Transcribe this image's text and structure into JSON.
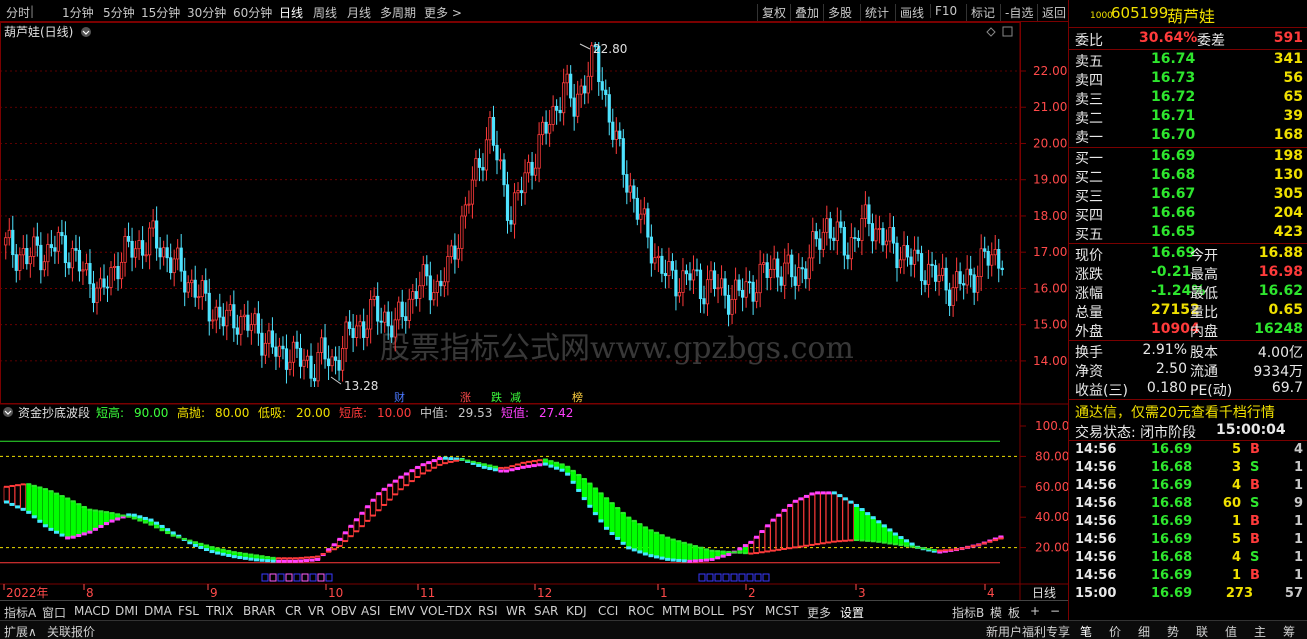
{
  "toolbar": {
    "periods": [
      "分时",
      "1分钟",
      "5分钟",
      "15分钟",
      "30分钟",
      "60分钟",
      "日线",
      "周线",
      "月线",
      "多周期",
      "更多 >"
    ],
    "active": "日线",
    "tools": [
      "复权",
      "叠加",
      "多股",
      "统计",
      "画线",
      "F10",
      "标记",
      "-自选",
      "返回"
    ]
  },
  "main_chart": {
    "title": "葫芦娃(日线)",
    "high_label": "22.80",
    "low_label": "13.28",
    "watermark": "股票指标公式网www.gpzbgs.com",
    "markers": [
      {
        "text": "财",
        "color": "#4a78ff"
      },
      {
        "text": "涨",
        "color": "#ff4a4a"
      },
      {
        "text": "跌",
        "color": "#3cff3c"
      },
      {
        "text": "减",
        "color": "#3cff3c"
      },
      {
        "text": "榜",
        "color": "#ffd040"
      }
    ]
  },
  "indicator": {
    "name": "资金抄底波段",
    "params": [
      {
        "label": "短高:",
        "value": "90.00",
        "color": "#3cff3c"
      },
      {
        "label": "高抛:",
        "value": "80.00",
        "color": "#f0e000"
      },
      {
        "label": "低吸:",
        "value": "20.00",
        "color": "#f0e000"
      },
      {
        "label": "短底:",
        "value": "10.00",
        "color": "#ff3b3b"
      },
      {
        "label": "中值:",
        "value": "29.53",
        "color": "#c8c8c8"
      },
      {
        "label": "短值:",
        "value": "27.42",
        "color": "#ff40ff"
      }
    ]
  },
  "dates": [
    "2022年",
    "8",
    "9",
    "10",
    "11",
    "12",
    "1",
    "2",
    "3",
    "4"
  ],
  "period_label": "日线",
  "chart_data": [
    {
      "type": "candlestick",
      "title": "葫芦娃(日线)",
      "ylim": [
        13.28,
        22.8
      ],
      "yticks": [
        "22.00",
        "21.00",
        "20.00",
        "19.00",
        "18.00",
        "17.00",
        "16.00",
        "15.00",
        "14.00"
      ],
      "high": 22.8,
      "low": 13.28,
      "close_trend": [
        17.2,
        17.0,
        16.8,
        17.1,
        16.9,
        17.3,
        17.0,
        16.6,
        16.3,
        15.8,
        16.4,
        16.9,
        17.1,
        17.2,
        17.4,
        17.0,
        16.7,
        16.3,
        16.0,
        15.6,
        15.3,
        15.1,
        15.2,
        15.0,
        14.8,
        14.5,
        14.1,
        14.3,
        14.0,
        13.8,
        14.2,
        13.9,
        14.4,
        14.9,
        15.0,
        15.4,
        15.2,
        14.9,
        15.5,
        16.0,
        16.2,
        16.0,
        16.5,
        17.5,
        18.5,
        19.5,
        20.4,
        19.2,
        18.0,
        18.8,
        19.5,
        20.2,
        20.8,
        21.6,
        21.0,
        21.8,
        22.4,
        21.2,
        20.0,
        19.0,
        18.2,
        17.4,
        16.7,
        16.3,
        16.2,
        16.4,
        16.0,
        16.2,
        15.9,
        15.8,
        15.9,
        16.1,
        16.4,
        16.6,
        16.5,
        16.3,
        16.7,
        17.2,
        17.8,
        17.4,
        17.1,
        17.6,
        17.9,
        17.5,
        17.2,
        17.0,
        16.8,
        16.6,
        16.4,
        16.2,
        16.0,
        16.2,
        16.4,
        16.8,
        16.9
      ]
    },
    {
      "type": "line",
      "title": "资金抄底波段",
      "ylim": [
        0,
        100
      ],
      "yticks": [
        "100.0",
        "80.00",
        "60.00",
        "40.00",
        "20.00"
      ],
      "thresholds": {
        "短高": 90,
        "高抛": 80,
        "低吸": 20,
        "短底": 10
      },
      "series": [
        {
          "name": "中值",
          "values": [
            60,
            62,
            58,
            52,
            45,
            43,
            40,
            35,
            28,
            24,
            20,
            17,
            15,
            13,
            13,
            14,
            20,
            32,
            45,
            58,
            68,
            75,
            78,
            75,
            72,
            76,
            78,
            74,
            64,
            52,
            40,
            32,
            26,
            22,
            18,
            17,
            16,
            18,
            20,
            22,
            24,
            25,
            24,
            22,
            20,
            18,
            19,
            22,
            26
          ]
        },
        {
          "name": "短值",
          "values": [
            50,
            44,
            33,
            26,
            30,
            37,
            42,
            38,
            30,
            22,
            17,
            14,
            12,
            11,
            11,
            12,
            24,
            40,
            56,
            66,
            74,
            79,
            78,
            73,
            70,
            73,
            75,
            70,
            50,
            32,
            20,
            15,
            12,
            11,
            12,
            16,
            24,
            38,
            50,
            56,
            56,
            48,
            38,
            28,
            20,
            17,
            19,
            22,
            27
          ]
        }
      ]
    }
  ],
  "quote_panel": {
    "code": "605199",
    "name": "葫芦娃",
    "code_prefix": "1000",
    "wei_bi_label": "委比",
    "wei_bi": "30.64%",
    "wei_cha_label": "委差",
    "wei_cha": "591",
    "asks": [
      {
        "label": "卖五",
        "price": "16.74",
        "vol": "341"
      },
      {
        "label": "卖四",
        "price": "16.73",
        "vol": "56"
      },
      {
        "label": "卖三",
        "price": "16.72",
        "vol": "65"
      },
      {
        "label": "卖二",
        "price": "16.71",
        "vol": "39"
      },
      {
        "label": "卖一",
        "price": "16.70",
        "vol": "168"
      }
    ],
    "bids": [
      {
        "label": "买一",
        "price": "16.69",
        "vol": "198"
      },
      {
        "label": "买二",
        "price": "16.68",
        "vol": "130"
      },
      {
        "label": "买三",
        "price": "16.67",
        "vol": "305"
      },
      {
        "label": "买四",
        "price": "16.66",
        "vol": "204"
      },
      {
        "label": "买五",
        "price": "16.65",
        "vol": "423"
      }
    ],
    "stats": [
      {
        "l1": "现价",
        "v1": "16.69",
        "c1": "grn",
        "l2": "今开",
        "v2": "16.88",
        "c2": "yel"
      },
      {
        "l1": "涨跌",
        "v1": "-0.21",
        "c1": "grn",
        "l2": "最高",
        "v2": "16.98",
        "c2": "red"
      },
      {
        "l1": "涨幅",
        "v1": "-1.24%",
        "c1": "grn",
        "l2": "最低",
        "v2": "16.62",
        "c2": "grn"
      },
      {
        "l1": "总量",
        "v1": "27152",
        "c1": "yel",
        "l2": "量比",
        "v2": "0.65",
        "c2": "yel"
      },
      {
        "l1": "外盘",
        "v1": "10904",
        "c1": "red",
        "l2": "内盘",
        "v2": "16248",
        "c2": "grn"
      }
    ],
    "fin": [
      {
        "l1": "换手",
        "v1": "2.91%",
        "l2": "股本",
        "v2": "4.00亿"
      },
      {
        "l1": "净资",
        "v1": "2.50",
        "l2": "流通",
        "v2": "9334万"
      },
      {
        "l1": "收益(三)",
        "v1": "0.180",
        "l2": "PE(动)",
        "v2": "69.7"
      }
    ],
    "ad": "通达信，仅需20元查看千档行情",
    "trade_status_label": "交易状态: 闭市阶段",
    "trade_time": "15:00:04",
    "ticks": [
      {
        "t": "14:56",
        "p": "16.69",
        "v": "5",
        "bs": "B",
        "n": "4"
      },
      {
        "t": "14:56",
        "p": "16.68",
        "v": "3",
        "bs": "S",
        "n": "1"
      },
      {
        "t": "14:56",
        "p": "16.69",
        "v": "4",
        "bs": "B",
        "n": "1"
      },
      {
        "t": "14:56",
        "p": "16.68",
        "v": "60",
        "bs": "S",
        "n": "9"
      },
      {
        "t": "14:56",
        "p": "16.69",
        "v": "1",
        "bs": "B",
        "n": "1"
      },
      {
        "t": "14:56",
        "p": "16.69",
        "v": "5",
        "bs": "B",
        "n": "1"
      },
      {
        "t": "14:56",
        "p": "16.68",
        "v": "4",
        "bs": "S",
        "n": "1"
      },
      {
        "t": "14:56",
        "p": "16.69",
        "v": "1",
        "bs": "B",
        "n": "1"
      },
      {
        "t": "15:00",
        "p": "16.69",
        "v": "273",
        "bs": "",
        "n": "57"
      }
    ],
    "tabs": [
      "笔",
      "价",
      "细",
      "势",
      "联",
      "值",
      "主",
      "筹"
    ]
  },
  "bottom_tabs": [
    "指标A",
    "窗口",
    "MACD",
    "DMI",
    "DMA",
    "FSL",
    "TRIX",
    "BRAR",
    "CR",
    "VR",
    "OBV",
    "ASI",
    "EMV",
    "VOL-TDX",
    "RSI",
    "WR",
    "SAR",
    "KDJ",
    "CCI",
    "ROC",
    "MTM",
    "BOLL",
    "PSY",
    "MCST",
    "更多",
    "设置"
  ],
  "bottom_right": [
    "指标B",
    "模",
    "板",
    "+",
    "−"
  ],
  "status": {
    "expand": "扩展∧",
    "related": "关联报价",
    "promo": "新用户福利专享"
  },
  "colors": {
    "up": "#ff3b3b",
    "down": "#4fe3ff",
    "grid": "#7a0000"
  }
}
